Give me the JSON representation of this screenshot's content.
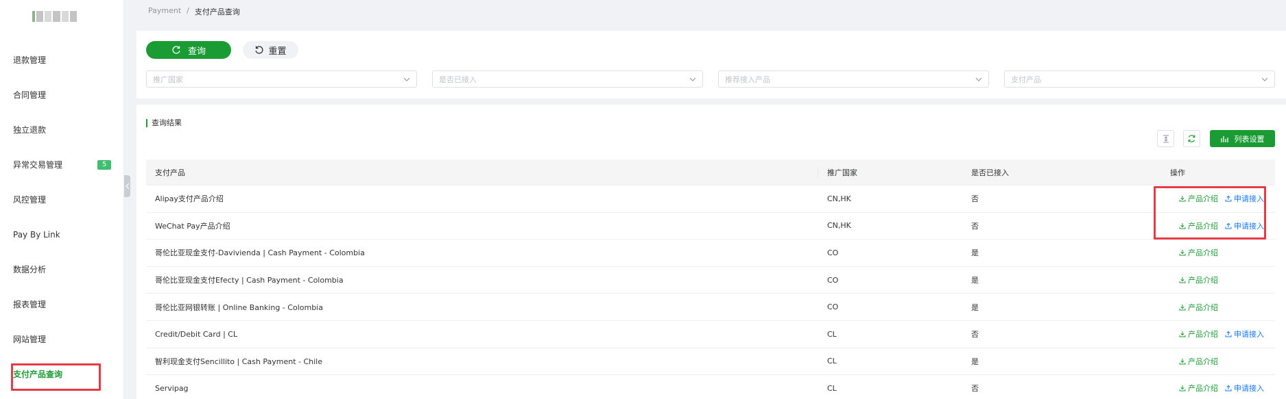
{
  "colors": {
    "accent": "#1a9b33",
    "highlight": "#e63b45",
    "link": "#1677ff"
  },
  "sidebar": {
    "logo_icon": "blurred-logo",
    "items": [
      {
        "label": "退款管理"
      },
      {
        "label": "合同管理"
      },
      {
        "label": "独立退款"
      },
      {
        "label": "异常交易管理",
        "badge": "5"
      },
      {
        "label": "风控管理"
      },
      {
        "label": "Pay By Link"
      },
      {
        "label": "数据分析"
      },
      {
        "label": "报表管理"
      },
      {
        "label": "网站管理"
      },
      {
        "label": "支付产品查询",
        "active": true
      }
    ]
  },
  "breadcrumb": {
    "parent": "Payment",
    "separator": "/",
    "current": "支付产品查询"
  },
  "search": {
    "query_label": "查询",
    "reset_label": "重置",
    "filters": [
      {
        "placeholder": "推广国家"
      },
      {
        "placeholder": "是否已接入"
      },
      {
        "placeholder": "推荐接入产品"
      },
      {
        "placeholder": "支付产品"
      }
    ]
  },
  "result": {
    "title": "查询结果",
    "column_settings_label": "列表设置",
    "columns": [
      "支付产品",
      "推广国家",
      "是否已接入",
      "操作"
    ],
    "action_intro": "产品介绍",
    "action_apply": "申请接入",
    "rows": [
      {
        "product": "Alipay支付产品介绍",
        "country": "CN,HK",
        "connected": "否",
        "apply": true
      },
      {
        "product": "WeChat Pay产品介绍",
        "country": "CN,HK",
        "connected": "否",
        "apply": true
      },
      {
        "product": "哥伦比亚现金支付-Davivienda | Cash Payment - Colombia",
        "country": "CO",
        "connected": "是",
        "apply": false
      },
      {
        "product": "哥伦比亚现金支付Efecty | Cash Payment - Colombia",
        "country": "CO",
        "connected": "是",
        "apply": false
      },
      {
        "product": "哥伦比亚网银转账 | Online Banking - Colombia",
        "country": "CO",
        "connected": "是",
        "apply": false
      },
      {
        "product": "Credit/Debit Card | CL",
        "country": "CL",
        "connected": "否",
        "apply": true
      },
      {
        "product": "智利现金支付Sencillito | Cash Payment - Chile",
        "country": "CL",
        "connected": "是",
        "apply": false
      },
      {
        "product": "Servipag",
        "country": "CL",
        "connected": "否",
        "apply": true
      }
    ]
  }
}
